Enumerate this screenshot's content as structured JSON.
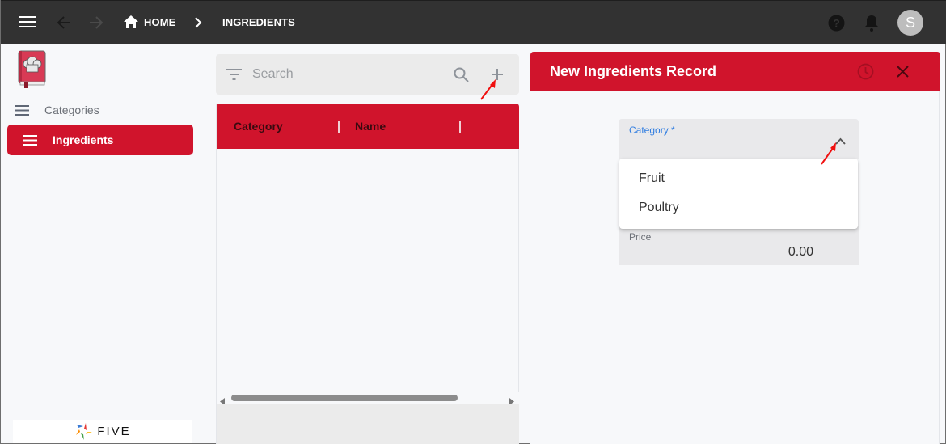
{
  "topbar": {
    "breadcrumb": [
      {
        "label": "HOME",
        "icon": "home-icon"
      },
      {
        "label": "INGREDIENTS"
      }
    ],
    "avatar_initial": "S",
    "icons": [
      "menu-icon",
      "back-arrow-icon",
      "forward-arrow-icon",
      "help-icon",
      "bell-icon"
    ]
  },
  "sidebar": {
    "items": [
      {
        "label": "Categories",
        "icon": "menu-icon",
        "active": false
      },
      {
        "label": "Ingredients",
        "icon": "menu-icon",
        "active": true
      }
    ],
    "footer_logo_text": "FIVE"
  },
  "list": {
    "search_placeholder": "Search",
    "columns": [
      "Category",
      "Name"
    ]
  },
  "form": {
    "title": "New Ingredients Record",
    "fields": {
      "category": {
        "label": "Category *",
        "value": ""
      },
      "price": {
        "label": "Price",
        "value": "0.00"
      }
    },
    "dropdown_options": [
      "Fruit",
      "Poultry"
    ]
  },
  "colors": {
    "brand_red": "#d0142c",
    "topbar": "#323232",
    "focus_blue": "#2f7de1"
  }
}
